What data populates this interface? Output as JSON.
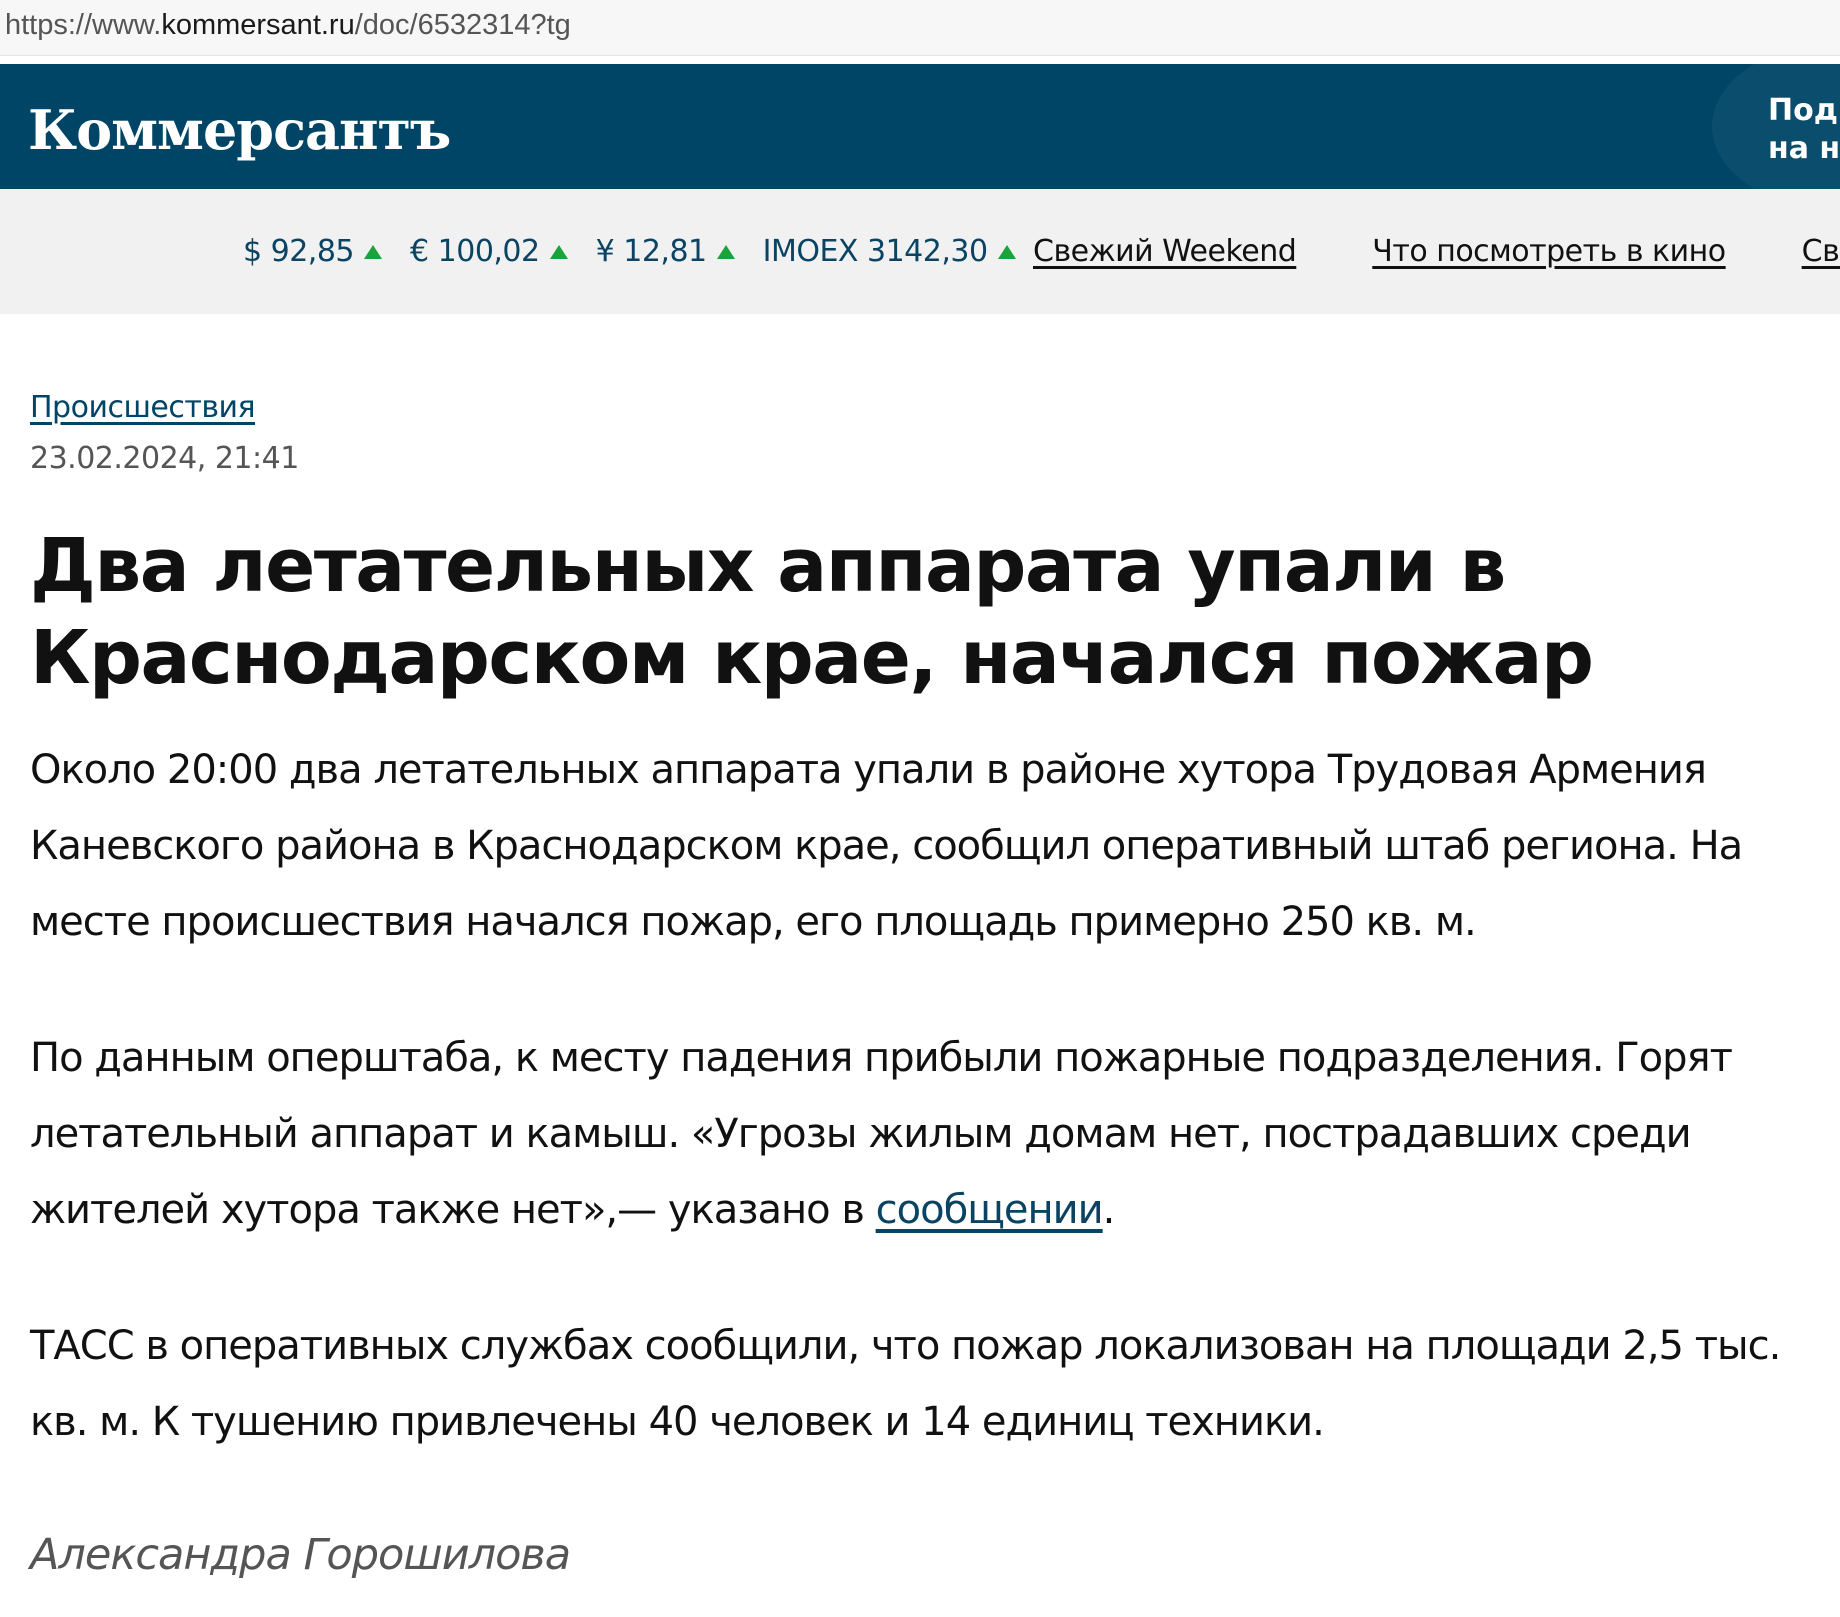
{
  "browser": {
    "url_prefix": "https://www.",
    "url_host": "kommersant.ru",
    "url_path": "/doc/6532314?tg"
  },
  "header": {
    "logo": "Коммерсантъ",
    "subscribe_line1": "Подп",
    "subscribe_line2": "на на"
  },
  "ticker": {
    "quotes": [
      {
        "label": "$ 92,85",
        "trend": "up"
      },
      {
        "label": "€ 100,02",
        "trend": "up"
      },
      {
        "label": "¥ 12,81",
        "trend": "up"
      },
      {
        "label": "IMOEX 3142,30",
        "trend": "up"
      }
    ],
    "links": [
      "Свежий Weekend",
      "Что посмотреть в кино",
      "Свеж"
    ],
    "arrow_color": "#1aa33a"
  },
  "article": {
    "rubric": "Происшествия",
    "date": "23.02.2024, 21:41",
    "headline": "Два летательных аппарата упали в Краснодарском крае, начался пожар",
    "p1": "Около 20:00 два летательных аппарата упали в районе хутора Трудовая Армения Каневского района в Краснодарском крае, сообщил оперативный штаб региона. На месте происшествия начался пожар, его площадь примерно 250 кв. м.",
    "p2_text": "По данным оперштаба, к месту падения прибыли пожарные подразделения. Горят летательный аппарат и камыш. «Угрозы жилым домам нет, пострадавших среди жителей хутора также нет»,— указано в ",
    "p2_link": "сообщении",
    "p2_end": ".",
    "p3": "ТАСС в оперативных службах сообщили, что пожар локализован на площади 2,5 тыс. кв. м. К тушению привлечены 40 человек и 14 единиц техники.",
    "author": "Александра Горошилова"
  },
  "colors": {
    "brand": "#004565",
    "ticker_bg": "#f1f1f1",
    "link": "#0b4463"
  }
}
